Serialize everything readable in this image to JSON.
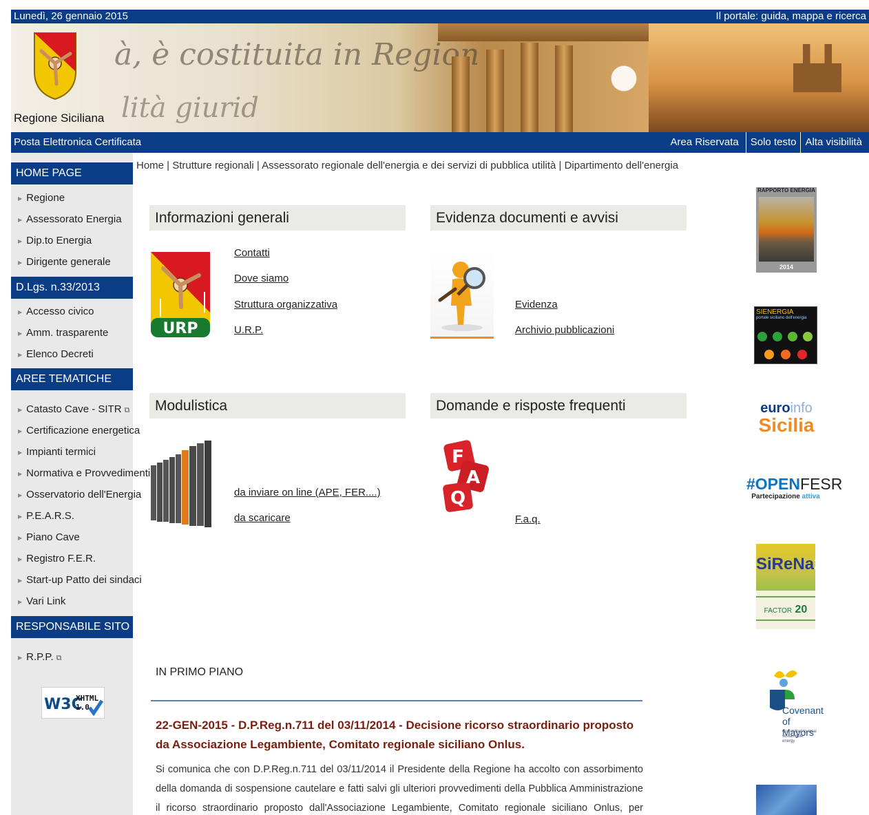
{
  "topbar": {
    "date": "Lunedì, 26 gennaio 2015",
    "portal": "Il portale: guida, mappa e ricerca"
  },
  "banner": {
    "site_name": "Regione Siciliana",
    "script_text_1": "à, è costituita in Region",
    "script_text_2": "lità giurid"
  },
  "navbar": {
    "pec": "Posta Elettronica Certificata",
    "links": [
      "Area Riservata",
      "Solo testo",
      "Alta visibilità"
    ]
  },
  "sidebar": {
    "sections": [
      {
        "title": "HOME PAGE",
        "items": [
          "Regione",
          "Assessorato Energia",
          "Dip.to Energia",
          "Dirigente generale"
        ]
      },
      {
        "title": "D.Lgs. n.33/2013",
        "items": [
          "Accesso civico",
          "Amm. trasparente",
          "Elenco Decreti"
        ]
      },
      {
        "title": "AREE TEMATICHE",
        "items": [
          "Catasto Cave - SITR",
          "Certificazione energetica",
          "Impianti termici",
          "Normativa e Provvedimenti",
          "Osservatorio dell'Energia",
          "P.E.A.R.S.",
          "Piano Cave",
          "Registro F.E.R.",
          "Start-up Patto dei sindaci",
          "Vari Link"
        ]
      },
      {
        "title": "RESPONSABILE SITO",
        "items": [
          "R.P.P."
        ]
      }
    ],
    "w3c_badge": {
      "w3c": "W3C",
      "xhtml": "XHTML",
      "version": "1.0"
    }
  },
  "breadcrumb": {
    "items": [
      "Home",
      "Strutture regionali",
      "Assessorato regionale dell'energia e dei servizi di pubblica utilità"
    ],
    "current": "Dipartimento dell'energia",
    "sep": " | "
  },
  "boxes": {
    "info": {
      "title": "Informazioni generali",
      "links": [
        "Contatti",
        "Dove siamo",
        "Struttura organizzativa",
        "U.R.P."
      ],
      "image_label": "URP"
    },
    "evidenza": {
      "title": "Evidenza documenti e avvisi",
      "links": [
        "Evidenza",
        "Archivio pubblicazioni"
      ]
    },
    "modulistica": {
      "title": "Modulistica",
      "links": [
        "da inviare on line (APE, FER....)",
        "da scaricare"
      ]
    },
    "faq": {
      "title": "Domande e risposte frequenti",
      "links": [
        "F.a.q."
      ],
      "image_letters": [
        "F",
        "A",
        "Q"
      ]
    }
  },
  "news": {
    "heading": "IN PRIMO PIANO",
    "title": "22-GEN-2015 - D.P.Reg.n.711 del 03/11/2014 - Decisione ricorso straordinario proposto da Associazione Legambiente, Comitato regionale siciliano Onlus.",
    "text": "Si comunica che con D.P.Reg.n.711 del 03/11/2014 il Presidente della Regione ha accolto con assorbimento della domanda di sospensione cautelare e fatti salvi gli ulteriori provvedimenti della Pubblica Amministrazione il ricorso straordinario proposto dall'Associazione Legambiente, Comitato regionale siciliano Onlus, per \"l'annullamento del"
  },
  "right_banners": {
    "rapporto": {
      "title": "RAPPORTO ENERGIA",
      "year": "2014"
    },
    "sienergia": {
      "title": "SIENERGIA",
      "subtitle": "portale siciliano dell'energia"
    },
    "euroinfo": {
      "line1_a": "euro",
      "line1_b": "info",
      "line2": "Sicilia"
    },
    "openfesr": {
      "a": "#OPEN",
      "b": "FESR",
      "sub_a": "Partecipazione",
      "sub_b": "attiva"
    },
    "sirena": {
      "a": "SiReNa",
      "num": "2",
      "b": "FACTOR",
      "b_num": "20"
    },
    "covenant": {
      "line1": "Covenant",
      "line2": "of Mayors",
      "sub": "Committed to local sustainable energy"
    }
  }
}
